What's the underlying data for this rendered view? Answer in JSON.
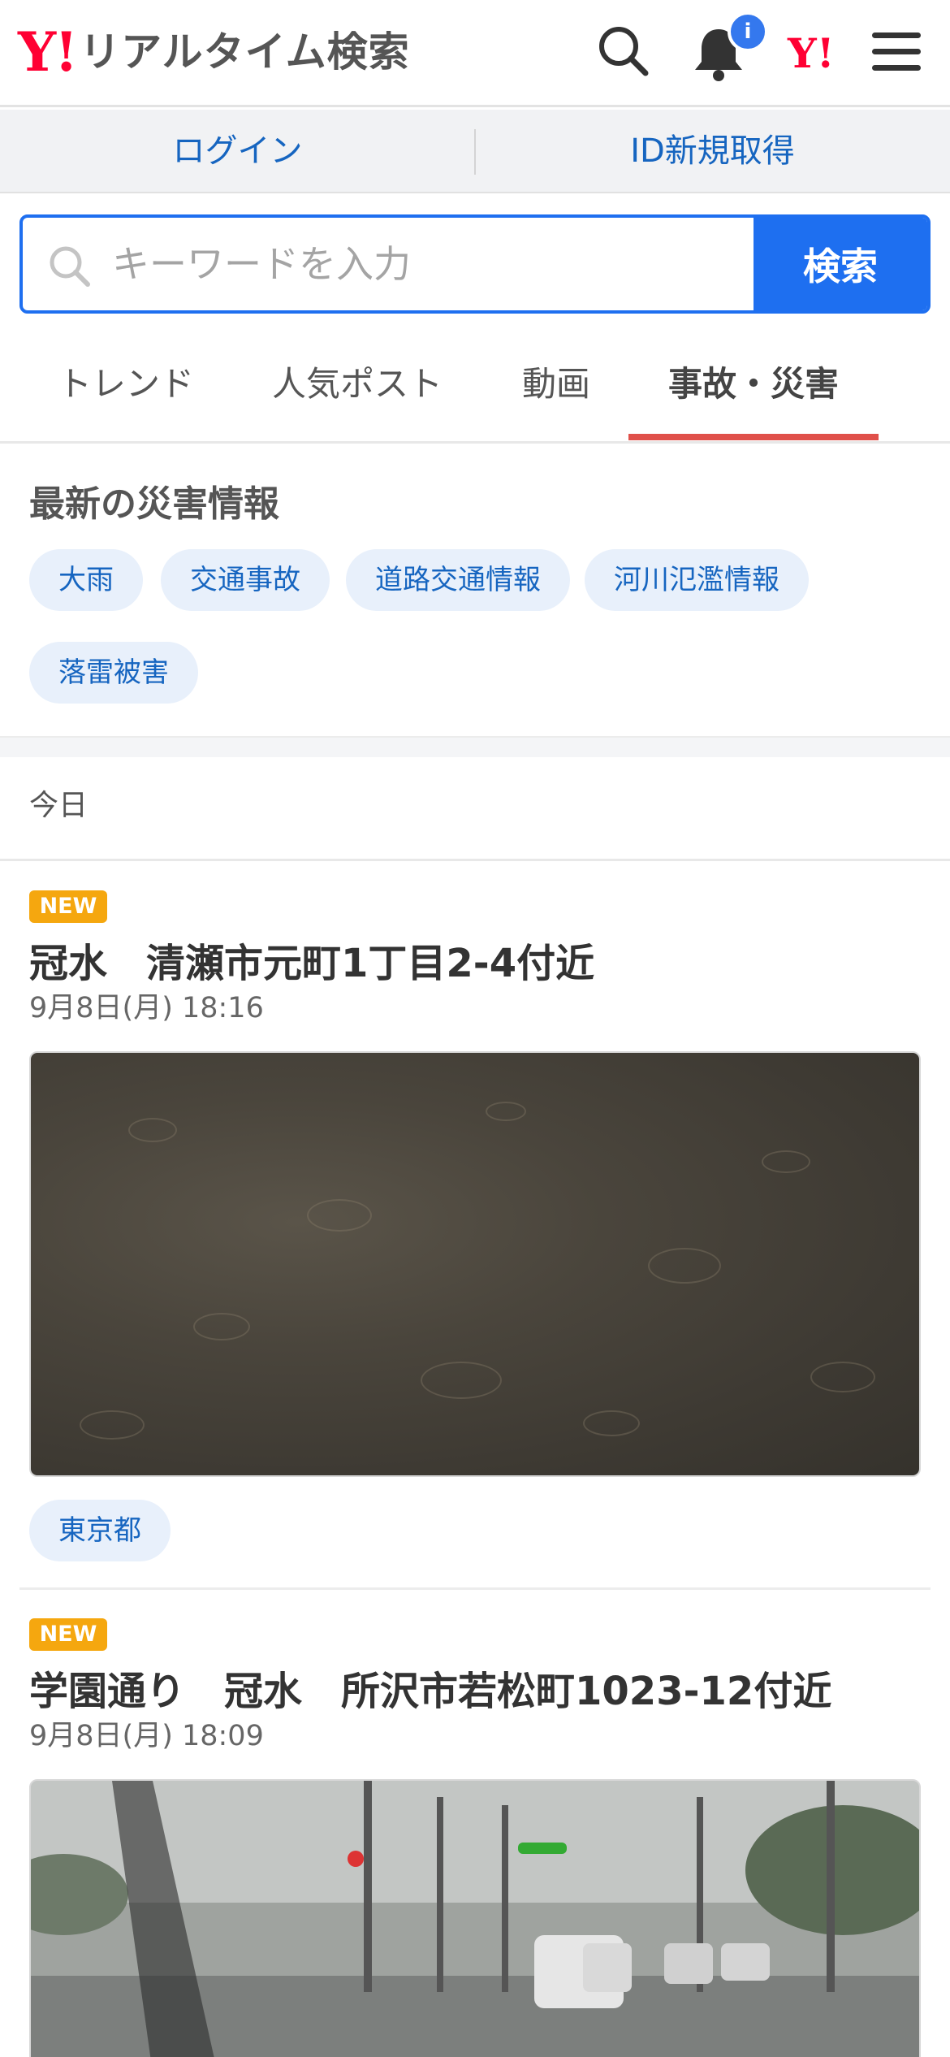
{
  "header": {
    "logo_mark": "Y!",
    "logo_text": "リアルタイム検索",
    "notification_badge": "i",
    "yahoo_mark": "Y!",
    "icons": [
      "search-icon",
      "bell-icon",
      "yahoo-japan-icon",
      "menu-icon"
    ],
    "brand_color": "#ff0033"
  },
  "loginbar": {
    "login": "ログイン",
    "signup": "ID新規取得"
  },
  "search": {
    "placeholder": "キーワードを入力",
    "button": "検索",
    "accent_color": "#1e6ff0"
  },
  "tabs": [
    {
      "label": "トレンド",
      "active": false
    },
    {
      "label": "人気ポスト",
      "active": false
    },
    {
      "label": "動画",
      "active": false
    },
    {
      "label": "事故・災害",
      "active": true
    }
  ],
  "disaster": {
    "title": "最新の災害情報",
    "chips": [
      "大雨",
      "交通事故",
      "道路交通情報",
      "河川氾濫情報",
      "落雷被害"
    ]
  },
  "section_label": "今日",
  "posts": [
    {
      "badge": "NEW",
      "title": "冠水　清瀬市元町1丁目2-4付近",
      "date": "9月8日(月) 18:16",
      "tag": "東京都"
    },
    {
      "badge": "NEW",
      "title": "学園通り　冠水　所沢市若松町1023-12付近",
      "date": "9月8日(月) 18:09"
    }
  ]
}
